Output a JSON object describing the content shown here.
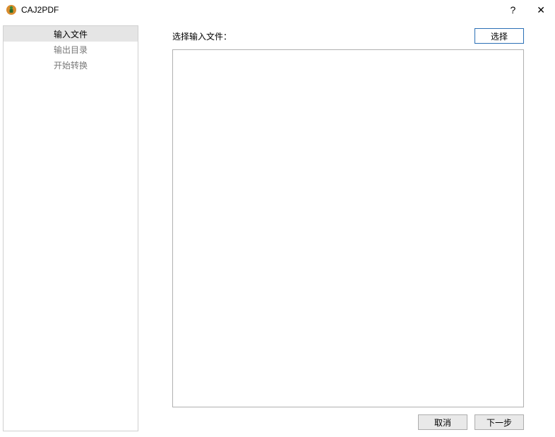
{
  "window": {
    "title": "CAJ2PDF"
  },
  "titlebar": {
    "help_symbol": "?",
    "close_symbol": "✕"
  },
  "sidebar": {
    "items": [
      {
        "label": "输入文件",
        "selected": true
      },
      {
        "label": "输出目录",
        "selected": false
      },
      {
        "label": "开始转换",
        "selected": false
      }
    ]
  },
  "main": {
    "input_label": "选择输入文件：",
    "select_button": "选择",
    "file_list": []
  },
  "footer": {
    "cancel_label": "取消",
    "next_label": "下一步"
  }
}
